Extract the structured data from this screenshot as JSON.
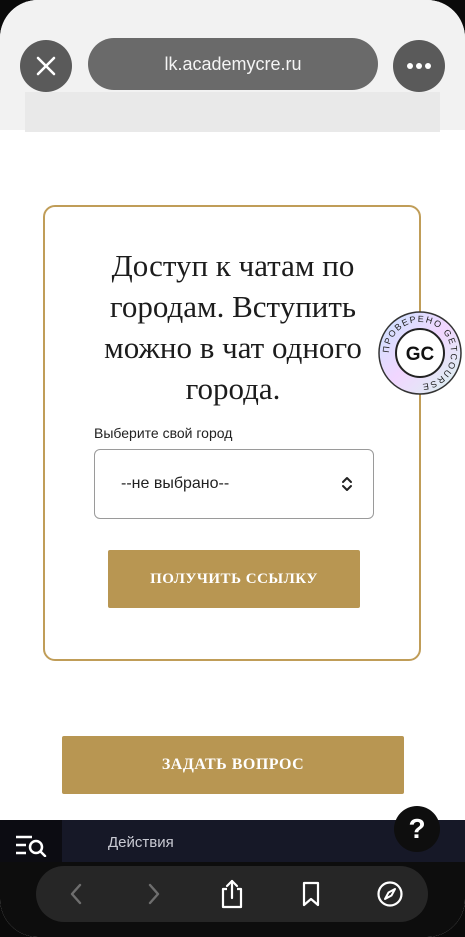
{
  "browser": {
    "url": "lk.academycre.ru",
    "close_icon": "close-icon",
    "more_icon": "more-dots-icon"
  },
  "card": {
    "title": "Доступ к чатам по городам. Вступить можно в чат одного города.",
    "city_label": "Выберите свой город",
    "city_select_value": "--не выбрано--",
    "get_link_button": "ПОЛУЧИТЬ ССЫЛКУ"
  },
  "badge": {
    "logo_text": "GC",
    "ring_text": "ПРОВЕРЕНО GETCOURSE"
  },
  "ask_button": "ЗАДАТЬ ВОПРОС",
  "actions_bar": {
    "label": "Действия",
    "help": "?"
  },
  "toolbar": {
    "icons": [
      "back-icon",
      "forward-icon",
      "share-icon",
      "bookmarks-icon",
      "compass-icon"
    ]
  },
  "colors": {
    "accent": "#b89652",
    "card_border": "#c09d58",
    "actions_bar_bg": "#161827"
  }
}
